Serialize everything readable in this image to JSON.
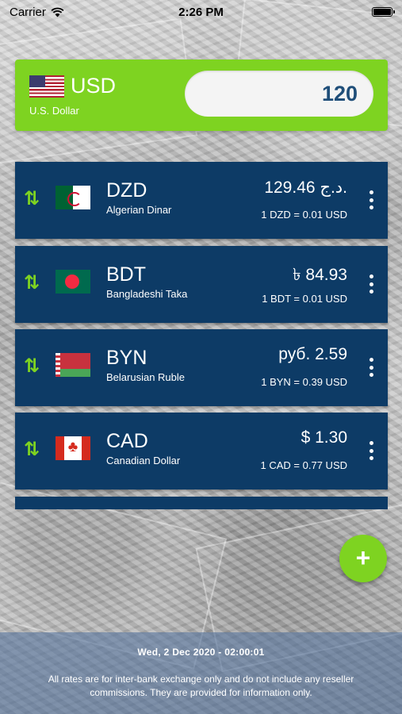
{
  "status_bar": {
    "carrier": "Carrier",
    "time": "2:26 PM"
  },
  "base": {
    "code": "USD",
    "name": "U.S. Dollar",
    "amount": "120",
    "flag_icon": "us-flag-icon"
  },
  "rows": [
    {
      "code": "DZD",
      "name": "Algerian Dinar",
      "value": "129.46 د.ج.",
      "rate": "1 DZD = 0.01 USD",
      "flag_icon": "algeria-flag-icon"
    },
    {
      "code": "BDT",
      "name": "Bangladeshi Taka",
      "value": "৳ 84.93",
      "rate": "1 BDT = 0.01 USD",
      "flag_icon": "bangladesh-flag-icon"
    },
    {
      "code": "BYN",
      "name": "Belarusian Ruble",
      "value": "руб. 2.59",
      "rate": "1 BYN = 0.39 USD",
      "flag_icon": "belarus-flag-icon"
    },
    {
      "code": "CAD",
      "name": "Canadian Dollar",
      "value": "$ 1.30",
      "rate": "1 CAD = 0.77 USD",
      "flag_icon": "canada-flag-icon"
    }
  ],
  "icons": {
    "swap": "⇅",
    "add": "+"
  },
  "footer": {
    "date": "Wed, 2 Dec 2020 - 02:00:01",
    "note": "All rates are for inter-bank exchange only and do not include any reseller commissions. They are provided for information only."
  },
  "colors": {
    "accent_green": "#7ed321",
    "row_navy": "#0d3b66",
    "amount_text": "#1f4e79"
  }
}
